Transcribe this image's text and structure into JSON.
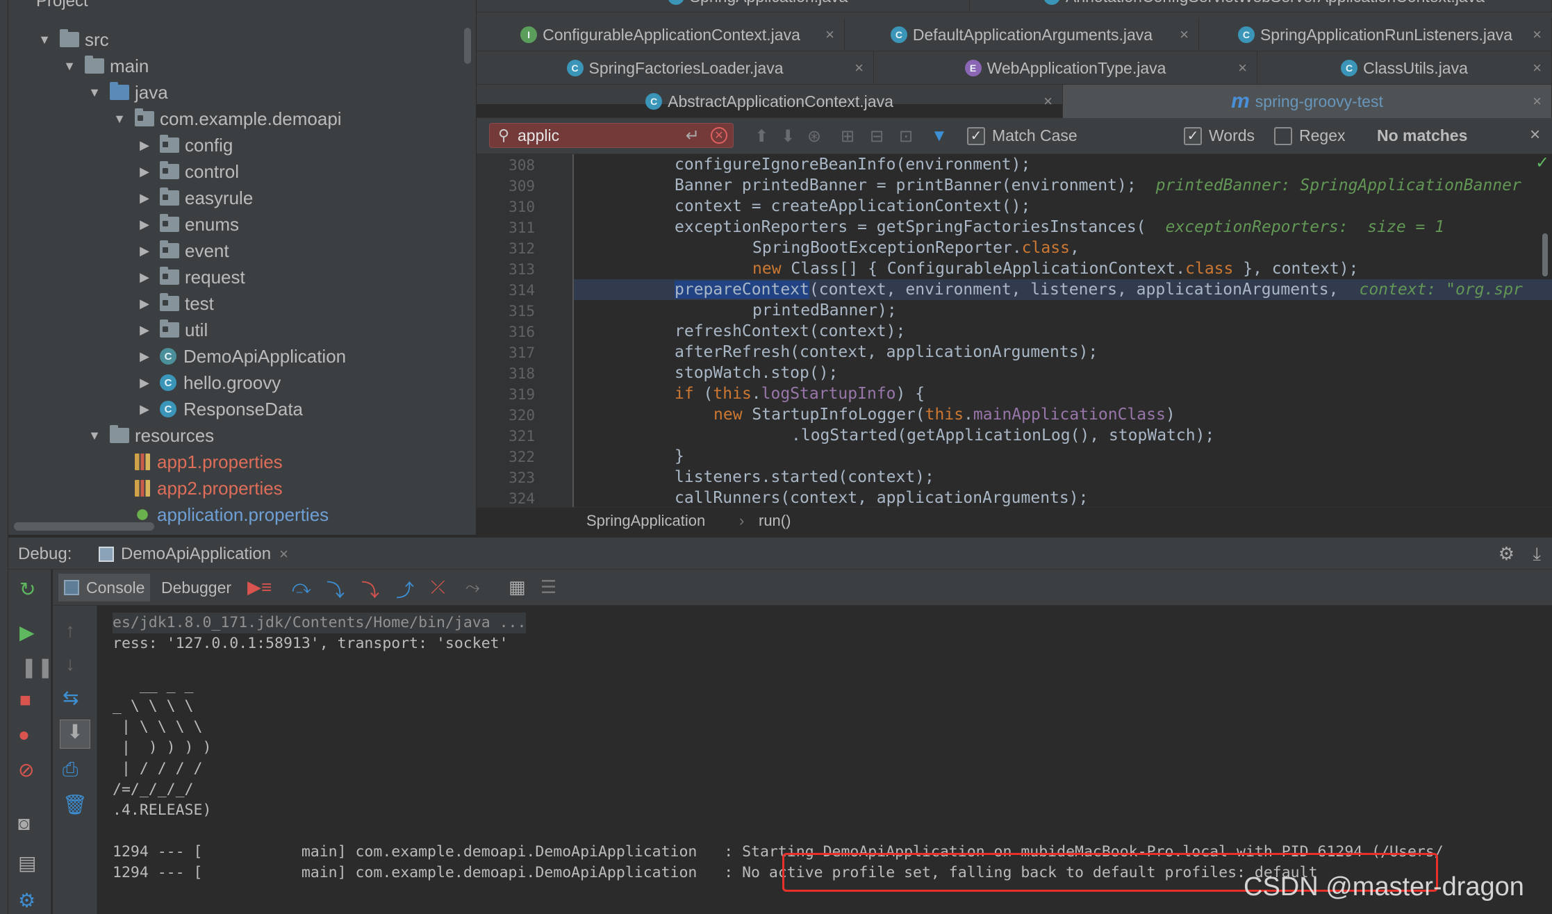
{
  "project": {
    "title": "Project",
    "tree": [
      {
        "label": "src",
        "depth": 0,
        "icon": "folder-icon",
        "expanded": true
      },
      {
        "label": "main",
        "depth": 1,
        "icon": "folder-icon",
        "expanded": true
      },
      {
        "label": "java",
        "depth": 2,
        "icon": "folder-blue-icon",
        "expanded": true
      },
      {
        "label": "com.example.demoapi",
        "depth": 3,
        "icon": "package-icon",
        "expanded": true
      },
      {
        "label": "config",
        "depth": 4,
        "icon": "package-icon"
      },
      {
        "label": "control",
        "depth": 4,
        "icon": "package-icon"
      },
      {
        "label": "easyrule",
        "depth": 4,
        "icon": "package-icon"
      },
      {
        "label": "enums",
        "depth": 4,
        "icon": "package-icon"
      },
      {
        "label": "event",
        "depth": 4,
        "icon": "package-icon"
      },
      {
        "label": "request",
        "depth": 4,
        "icon": "package-icon"
      },
      {
        "label": "test",
        "depth": 4,
        "icon": "package-icon"
      },
      {
        "label": "util",
        "depth": 4,
        "icon": "package-icon"
      },
      {
        "label": "DemoApiApplication",
        "depth": 4,
        "icon": "spring-class-icon"
      },
      {
        "label": "hello.groovy",
        "depth": 4,
        "icon": "class-icon"
      },
      {
        "label": "ResponseData",
        "depth": 4,
        "icon": "class-icon"
      },
      {
        "label": "resources",
        "depth": 2,
        "icon": "resources-folder-icon",
        "expanded": true
      },
      {
        "label": "app1.properties",
        "depth": 3,
        "icon": "properties-icon",
        "color": "#de6d5a"
      },
      {
        "label": "app2.properties",
        "depth": 3,
        "icon": "properties-icon",
        "color": "#de6d5a"
      },
      {
        "label": "application.properties",
        "depth": 3,
        "icon": "spring-properties-icon",
        "color": "#6e9fd6"
      }
    ]
  },
  "tabs": {
    "row0": [
      {
        "label": "SpringApplication.java",
        "icon": "class-icon"
      },
      {
        "label": "AnnotationConfigServletWebServerApplicationContext.java",
        "icon": "class-icon"
      }
    ],
    "row1": [
      {
        "label": "ConfigurableApplicationContext.java",
        "icon": "interface-icon",
        "letter": "I"
      },
      {
        "label": "DefaultApplicationArguments.java",
        "icon": "class-icon",
        "letter": "C"
      },
      {
        "label": "SpringApplicationRunListeners.java",
        "icon": "class-icon",
        "letter": "C"
      }
    ],
    "row2": [
      {
        "label": "SpringFactoriesLoader.java",
        "icon": "class-icon",
        "letter": "C"
      },
      {
        "label": "WebApplicationType.java",
        "icon": "enum-icon",
        "letter": "E"
      },
      {
        "label": "ClassUtils.java",
        "icon": "class-icon",
        "letter": "C"
      }
    ],
    "row3": [
      {
        "label": "AbstractApplicationContext.java",
        "icon": "class-icon",
        "letter": "C"
      },
      {
        "label": "spring-groovy-test",
        "icon": "module-m-icon",
        "letter": "m"
      }
    ]
  },
  "search": {
    "value": "applic",
    "match_case": "Match Case",
    "words": "Words",
    "regex": "Regex",
    "status": "No matches"
  },
  "code": {
    "lines": [
      {
        "n": "308"
      },
      {
        "n": "309"
      },
      {
        "n": "310"
      },
      {
        "n": "311"
      },
      {
        "n": "312"
      },
      {
        "n": "313"
      },
      {
        "n": "314"
      },
      {
        "n": "315"
      },
      {
        "n": "316"
      },
      {
        "n": "317"
      },
      {
        "n": "318"
      },
      {
        "n": "319"
      },
      {
        "n": "320"
      },
      {
        "n": "321"
      },
      {
        "n": "322"
      },
      {
        "n": "323"
      },
      {
        "n": "324"
      }
    ],
    "t": {
      "l308": "configureIgnoreBeanInfo(environment);",
      "l309a": "Banner printedBanner = printBanner(environment);",
      "l309h": "printedBanner: SpringApplicationBanner",
      "l310": "context = createApplicationContext();",
      "l311a": "exceptionReporters = getSpringFactoriesInstances(",
      "l311h": "exceptionReporters:  size = 1",
      "l312a": "SpringBootExceptionReporter.",
      "l312k": "class",
      "l312b": ",",
      "l313k1": "new",
      "l313a": " Class[] { ConfigurableApplicationContext.",
      "l313k2": "class",
      "l313b": " }, context);",
      "l314s": "prepareContext",
      "l314a": "(context, environment, listeners, applicationArguments,",
      "l314h": "context: \"org.spr",
      "l315": "printedBanner);",
      "l316": "refreshContext(context);",
      "l317": "afterRefresh(context, applicationArguments);",
      "l318": "stopWatch.stop();",
      "l319k1": "if",
      "l319a": " (",
      "l319k2": "this",
      "l319b": ".",
      "l319f": "logStartupInfo",
      "l319c": ") {",
      "l320k1": "new",
      "l320a": " StartupInfoLogger(",
      "l320k2": "this",
      "l320b": ".",
      "l320f": "mainApplicationClass",
      "l320c": ")",
      "l321": ".logStarted(getApplicationLog(), stopWatch);",
      "l322": "}",
      "l323": "listeners.started(context);",
      "l324": "callRunners(context, applicationArguments);"
    }
  },
  "breadcrumb": {
    "class": "SpringApplication",
    "sep": "›",
    "method": "run()"
  },
  "debug": {
    "label": "Debug:",
    "session": "DemoApiApplication",
    "console_tab": "Console",
    "debugger_tab": "Debugger"
  },
  "console": {
    "lines": [
      "es/jdk1.8.0_171.jdk/Contents/Home/bin/java ...",
      "ress: '127.0.0.1:58913', transport: 'socket'",
      "",
      "   __ _ _",
      "_ \\ \\ \\ \\",
      " | \\ \\ \\ \\",
      " |  ) ) ) )",
      " | / / / /",
      "/=/_/_/_/",
      ".4.RELEASE)",
      "",
      "1294 --- [           main] com.example.demoapi.DemoApiApplication   : Starting DemoApiApplication on mubideMacBook-Pro.local with PID 61294 (/Users/",
      "1294 --- [           main] com.example.demoapi.DemoApiApplication   : No active profile set, falling back to default profiles: default"
    ]
  },
  "watermark": "CSDN @master-dragon"
}
